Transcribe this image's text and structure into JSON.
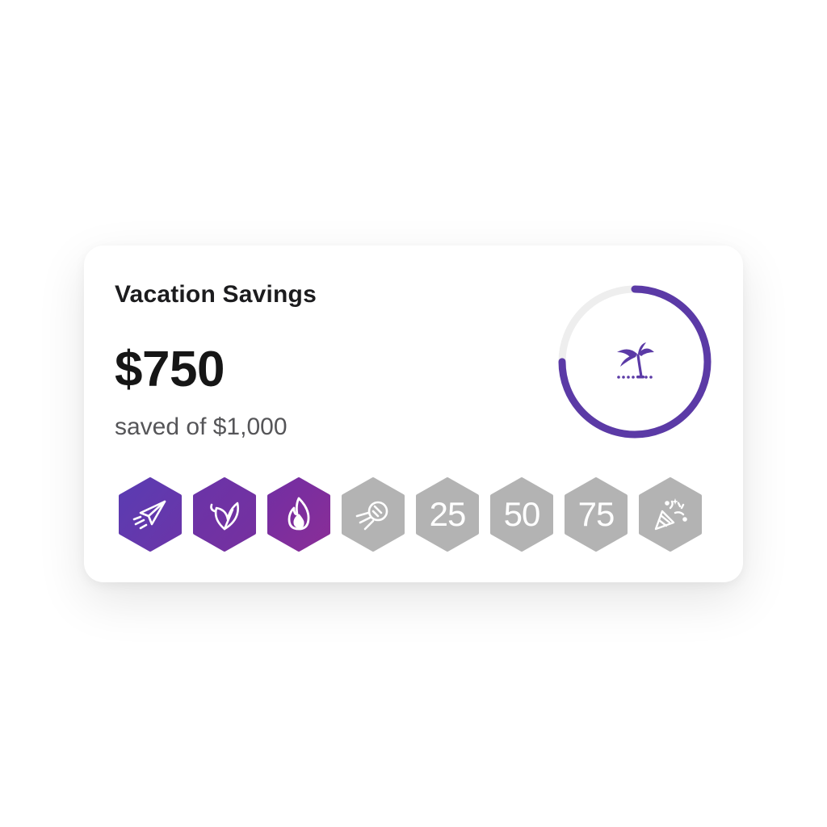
{
  "card": {
    "title": "Vacation Savings",
    "amount": "$750",
    "subtitle": "saved of $1,000"
  },
  "progress": {
    "fraction": 0.75,
    "icon": "palm-tree-icon",
    "color": "#5B3AA6",
    "track_color": "#EEEEEE"
  },
  "badges": [
    {
      "icon": "paper-plane-icon",
      "state": "earned"
    },
    {
      "icon": "leaf-icon",
      "state": "earned"
    },
    {
      "icon": "flame-icon",
      "state": "earned"
    },
    {
      "icon": "comet-icon",
      "state": "locked"
    },
    {
      "label": "25",
      "state": "locked"
    },
    {
      "label": "50",
      "state": "locked"
    },
    {
      "label": "75",
      "state": "locked"
    },
    {
      "icon": "party-popper-icon",
      "state": "locked"
    }
  ],
  "colors": {
    "earned_start": "#5C3BB0",
    "earned_end": "#7A2C9E",
    "locked": "#B3B3B3"
  }
}
